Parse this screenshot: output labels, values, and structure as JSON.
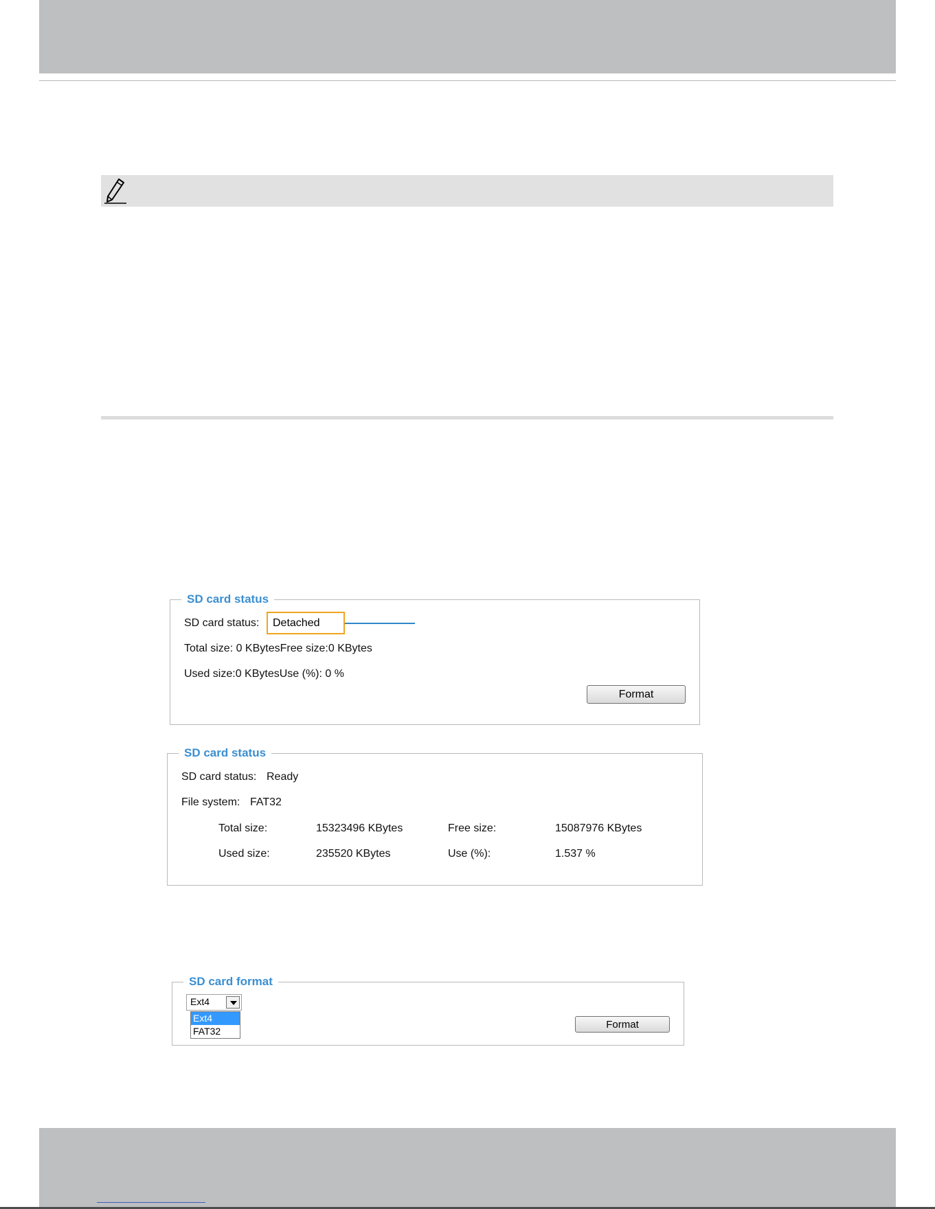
{
  "detached_panel": {
    "legend": "SD card status",
    "status_label": "SD card status:",
    "status_value": "Detached",
    "size_line": "Total size: 0  KBytesFree size:0  KBytes",
    "used_line": "Used size:0  KBytesUse (%):  0 %",
    "format_button": "Format"
  },
  "ready_panel": {
    "legend": "SD card status",
    "status_label": "SD card status:",
    "status_value": "Ready",
    "fs_label": "File system:",
    "fs_value": "FAT32",
    "total_label": "Total size:",
    "total_value": "15323496  KBytes",
    "free_label": "Free size:",
    "free_value": "15087976  KBytes",
    "used_label": "Used size:",
    "used_value": "235520  KBytes",
    "use_pct_label": "Use (%):",
    "use_pct_value": "1.537 %"
  },
  "format_panel": {
    "legend": "SD card format",
    "selected": "Ext4",
    "options": [
      "Ext4",
      "FAT32"
    ],
    "format_button": "Format"
  },
  "colors": {
    "legend_blue": "#3b8fd1",
    "highlight_orange": "#f0a51e",
    "callout_blue": "#2f86c8",
    "band_gray": "#bebfc1"
  },
  "icons": {
    "note": "pencil-icon"
  }
}
